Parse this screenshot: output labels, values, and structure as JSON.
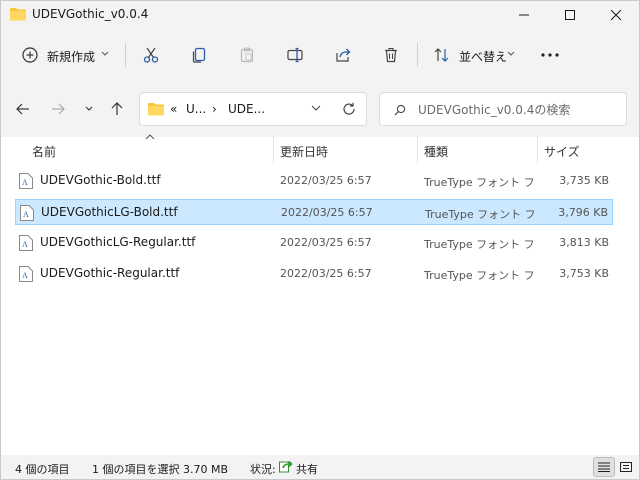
{
  "window": {
    "title": "UDEVGothic_v0.0.4"
  },
  "toolbar": {
    "new_label": "新規作成",
    "sort_label": "並べ替え"
  },
  "address": {
    "overflow": "«",
    "crumbs": [
      "U...",
      "UDE..."
    ],
    "separator": "›"
  },
  "search": {
    "placeholder": "UDEVGothic_v0.0.4の検索"
  },
  "columns": {
    "name": "名前",
    "date": "更新日時",
    "type": "種類",
    "size": "サイズ"
  },
  "files": [
    {
      "name": "UDEVGothic-Bold.ttf",
      "date": "2022/03/25 6:57",
      "type": "TrueType フォント フ...",
      "size": "3,735 KB",
      "selected": false
    },
    {
      "name": "UDEVGothicLG-Bold.ttf",
      "date": "2022/03/25 6:57",
      "type": "TrueType フォント フ...",
      "size": "3,796 KB",
      "selected": true
    },
    {
      "name": "UDEVGothicLG-Regular.ttf",
      "date": "2022/03/25 6:57",
      "type": "TrueType フォント フ...",
      "size": "3,813 KB",
      "selected": false
    },
    {
      "name": "UDEVGothic-Regular.ttf",
      "date": "2022/03/25 6:57",
      "type": "TrueType フォント フ...",
      "size": "3,753 KB",
      "selected": false
    }
  ],
  "status": {
    "item_count": "4 個の項目",
    "selection": "1 個の項目を選択  3.70 MB",
    "state_label": "状況:",
    "share_label": "共有"
  },
  "colors": {
    "accent": "#0067c0",
    "folder": "#f8c63d",
    "selection_bg": "#cce8ff",
    "selection_border": "#99d1ff"
  }
}
